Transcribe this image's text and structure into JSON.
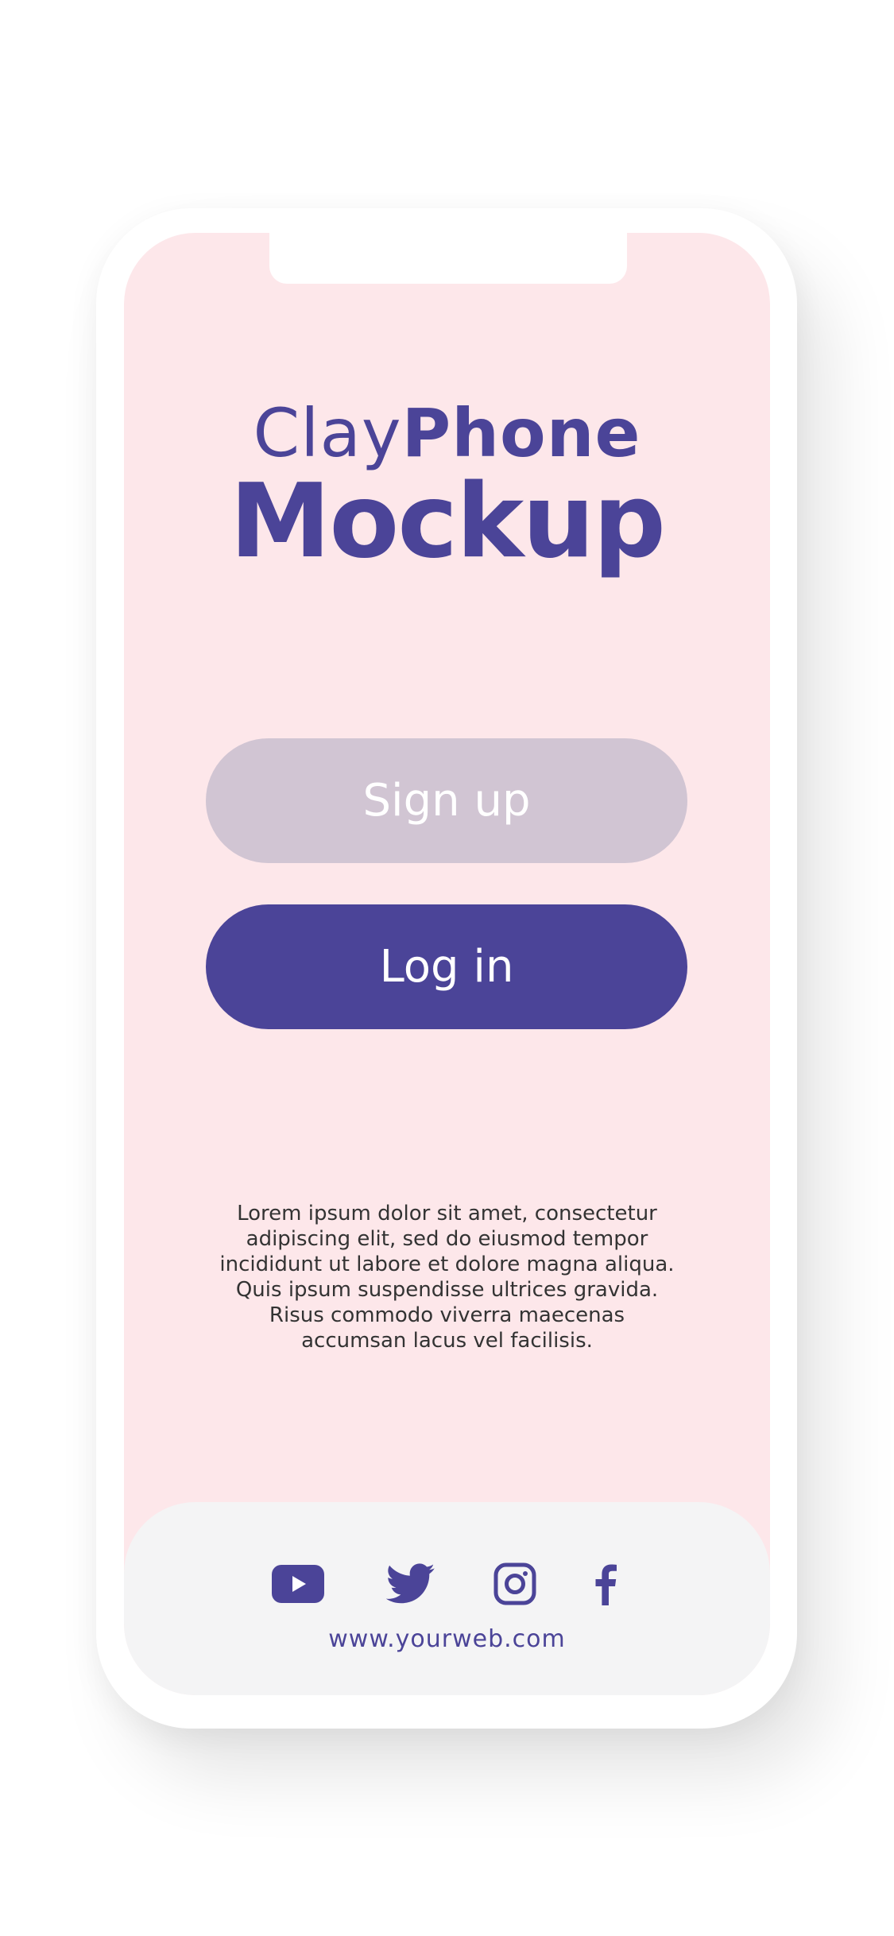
{
  "title": {
    "line1_light": "Clay",
    "line1_bold": "Phone",
    "line2": "Mockup"
  },
  "buttons": {
    "signup": "Sign up",
    "login": "Log in"
  },
  "description": "Lorem ipsum dolor sit amet, consectetur adipiscing elit, sed do eiusmod tempor incididunt ut labore et dolore magna aliqua. Quis ipsum suspendisse ultrices gravida. Risus commodo viverra maecenas accumsan lacus vel facilisis.",
  "footer": {
    "url": "www.yourweb.com",
    "icons": [
      "youtube-icon",
      "twitter-icon",
      "instagram-icon",
      "facebook-icon"
    ]
  },
  "colors": {
    "accent": "#4b4498",
    "screen_bg": "#fde7ea",
    "signup_bg": "#d1c5d3",
    "footer_bg": "#f4f4f5"
  }
}
